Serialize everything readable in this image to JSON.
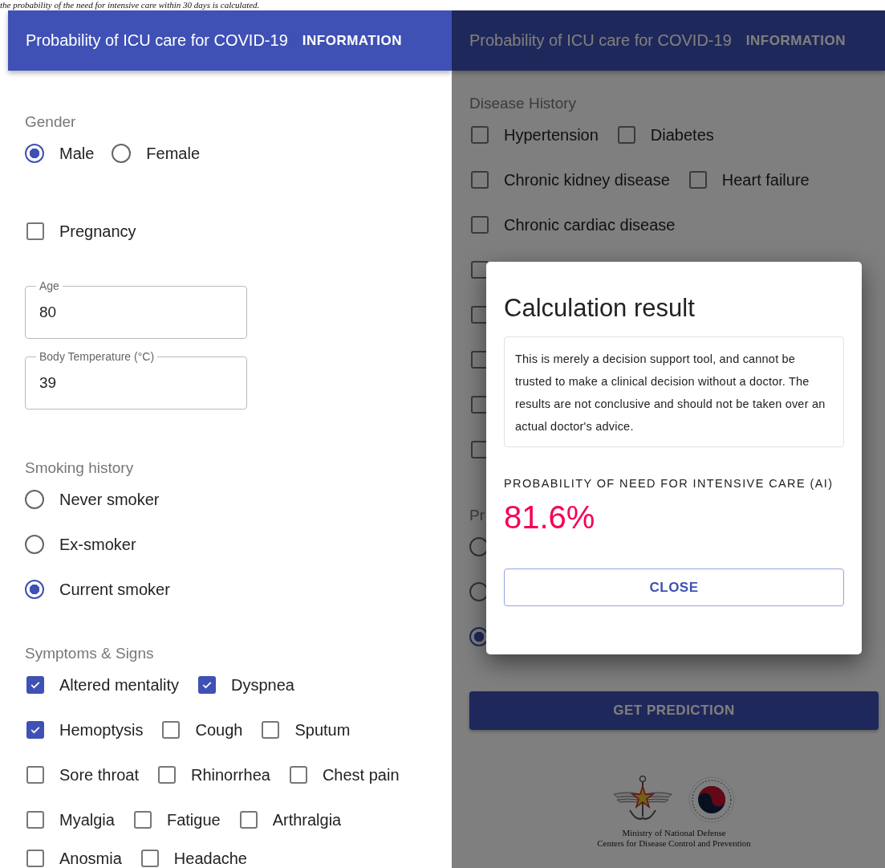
{
  "caption": "the probability of the need for intensive care within 30 days is calculated.",
  "left": {
    "app_bar": {
      "title": "Probability of ICU care for COVID-19",
      "action": "INFORMATION"
    },
    "gender": {
      "label": "Gender",
      "options": [
        {
          "label": "Male",
          "selected": true
        },
        {
          "label": "Female",
          "selected": false
        }
      ]
    },
    "pregnancy": {
      "label": "Pregnancy",
      "checked": false
    },
    "fields": [
      {
        "label": "Age",
        "value": "80"
      },
      {
        "label": "Body Temperature (°C)",
        "value": "39"
      }
    ],
    "smoking": {
      "label": "Smoking history",
      "options": [
        {
          "label": "Never smoker",
          "selected": false
        },
        {
          "label": "Ex-smoker",
          "selected": false
        },
        {
          "label": "Current smoker",
          "selected": true
        }
      ]
    },
    "symptoms": {
      "label": "Symptoms & Signs",
      "rows": [
        [
          {
            "label": "Altered mentality",
            "checked": true
          },
          {
            "label": "Dyspnea",
            "checked": true
          }
        ],
        [
          {
            "label": "Hemoptysis",
            "checked": true
          },
          {
            "label": "Cough",
            "checked": false
          },
          {
            "label": "Sputum",
            "checked": false
          }
        ],
        [
          {
            "label": "Sore throat",
            "checked": false
          },
          {
            "label": "Rhinorrhea",
            "checked": false
          },
          {
            "label": "Chest pain",
            "checked": false
          }
        ],
        [
          {
            "label": "Myalgia",
            "checked": false
          },
          {
            "label": "Fatigue",
            "checked": false
          },
          {
            "label": "Arthralgia",
            "checked": false
          }
        ],
        [
          {
            "label": "Anosmia",
            "checked": false
          },
          {
            "label": "Headache",
            "checked": false
          }
        ]
      ]
    }
  },
  "right": {
    "app_bar": {
      "title": "Probability of ICU care for COVID-19",
      "action": "INFORMATION"
    },
    "disease_history": {
      "label": "Disease History",
      "rows": [
        [
          {
            "label": "Hypertension",
            "checked": false
          },
          {
            "label": "Diabetes",
            "checked": false
          }
        ],
        [
          {
            "label": "Chronic kidney disease",
            "checked": false
          },
          {
            "label": "Heart failure",
            "checked": false
          }
        ],
        [
          {
            "label": "Chronic cardiac disease",
            "checked": false
          }
        ]
      ]
    },
    "hidden_checkboxes": [
      {
        "checked": false
      },
      {
        "checked": false
      },
      {
        "checked": false
      },
      {
        "checked": false
      },
      {
        "checked": false
      }
    ],
    "section_label": "Pr",
    "radios": [
      {
        "selected": false
      },
      {
        "selected": false
      },
      {
        "selected": true
      }
    ],
    "predict_button": "GET PREDICTION",
    "footer": [
      "Ministry of National Defense",
      "Centers for Disease Control and Prevention"
    ]
  },
  "dialog": {
    "title": "Calculation result",
    "disclaimer": "This is merely a decision support tool, and cannot be trusted to make a clinical decision without a doctor. The results are not conclusive and should not be taken over an actual doctor's advice.",
    "result_label": "PROBABILITY OF NEED FOR INTENSIVE CARE (AI)",
    "result": "81.6%",
    "close_button": "CLOSE"
  }
}
